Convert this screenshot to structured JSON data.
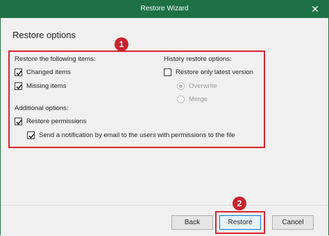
{
  "window": {
    "title": "Restore Wizard",
    "close_glyph": "✕"
  },
  "page": {
    "title": "Restore options"
  },
  "badges": {
    "first": "1",
    "second": "2"
  },
  "restore_items": {
    "heading": "Restore the following items:",
    "changed": {
      "label": "Changed items",
      "checked": true
    },
    "missing": {
      "label": "Missing items",
      "checked": true
    }
  },
  "history": {
    "heading": "History restore options:",
    "latest_only": {
      "label": "Restore only latest version",
      "checked": false
    },
    "overwrite": {
      "label": "Overwrite",
      "selected": true,
      "enabled": false
    },
    "merge": {
      "label": "Merge",
      "selected": false,
      "enabled": false
    }
  },
  "additional": {
    "heading": "Additional options:",
    "permissions": {
      "label": "Restore permissions",
      "checked": true
    },
    "notify": {
      "label": "Send a notification by email to the users with permissions to the file",
      "checked": true
    }
  },
  "buttons": {
    "back": "Back",
    "restore": "Restore",
    "cancel": "Cancel"
  },
  "colors": {
    "titlebar": "#1e7145",
    "highlight": "#d9232f",
    "badge": "#c9232e"
  },
  "icons": {
    "close": "close-icon",
    "check": "checkmark-icon"
  }
}
